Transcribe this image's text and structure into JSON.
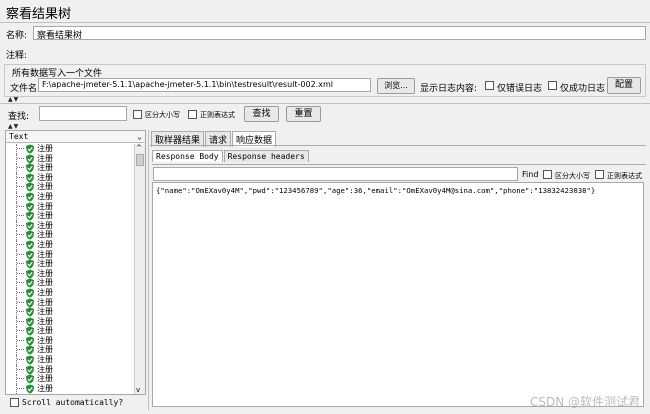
{
  "window_title": "察看结果树",
  "name": {
    "label": "名称:",
    "value": "察看结果树"
  },
  "comment": {
    "label": "注释:"
  },
  "file_group": {
    "title": "所有数据写入一个文件",
    "file_label": "文件名",
    "file_value": "F:\\apache-jmeter-5.1.1\\apache-jmeter-5.1.1\\bin\\testresult\\result-002.xml",
    "browse_label": "浏览...",
    "log_label": "显示日志内容:",
    "errors_only_label": "仅错误日志",
    "success_only_label": "仅成功日志",
    "config_label": "配置"
  },
  "search": {
    "label": "查找:",
    "value": "",
    "case_label": "区分大小写",
    "regex_label": "正则表达式",
    "find_label": "查找",
    "reset_label": "重置"
  },
  "tree": {
    "renderer": "Text",
    "item_label": "注册",
    "item_count": 26,
    "scroll_auto_label": "Scroll automatically?"
  },
  "tabs": [
    "取样器结果",
    "请求",
    "响应数据"
  ],
  "subtabs": [
    "Response Body",
    "Response headers"
  ],
  "response_search": {
    "find_label": "Find",
    "case_label": "区分大小写",
    "regex_label": "正则表达式"
  },
  "response_body": "{\"name\":\"OmEXav0y4M\",\"pwd\":\"123456789\",\"age\":36,\"email\":\"OmEXav0y4M@sina.com\",\"phone\":\"13832423038\"}",
  "watermark": "CSDN @软件测试君",
  "colors": {
    "shield": "#2e8b3e",
    "border": "#a8a8a8"
  }
}
